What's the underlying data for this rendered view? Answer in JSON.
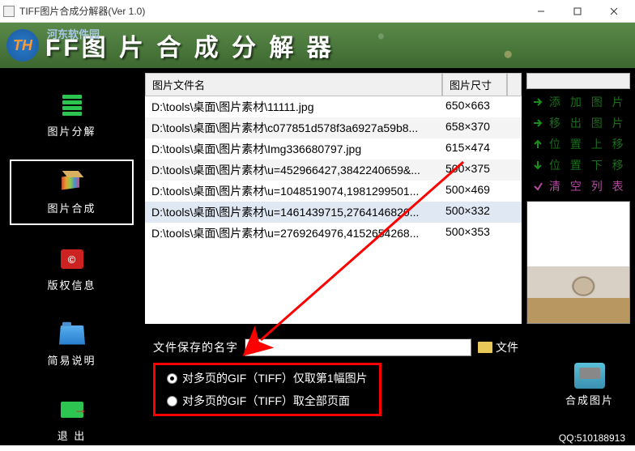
{
  "window": {
    "title": "TIFF图片合成分解器(Ver 1.0)"
  },
  "banner": {
    "logo_text": "TH",
    "sub": "河东软件园",
    "title": "FF图 片 合 成 分 解 器"
  },
  "sidebar": {
    "items": [
      {
        "label": "图片分解"
      },
      {
        "label": "图片合成"
      },
      {
        "label": "版权信息"
      },
      {
        "label": "简易说明"
      },
      {
        "label": "退 出"
      }
    ]
  },
  "table": {
    "col_name": "图片文件名",
    "col_size": "图片尺寸",
    "rows": [
      {
        "name": "D:\\tools\\桌面\\图片素材\\11111.jpg",
        "size": "650×663"
      },
      {
        "name": "D:\\tools\\桌面\\图片素材\\c077851d578f3a6927a59b8...",
        "size": "658×370"
      },
      {
        "name": "D:\\tools\\桌面\\图片素材\\Img336680797.jpg",
        "size": "615×474"
      },
      {
        "name": "D:\\tools\\桌面\\图片素材\\u=452966427,3842240659&...",
        "size": "500×375"
      },
      {
        "name": "D:\\tools\\桌面\\图片素材\\u=1048519074,1981299501...",
        "size": "500×469"
      },
      {
        "name": "D:\\tools\\桌面\\图片素材\\u=1461439715,2764146820...",
        "size": "500×332"
      },
      {
        "name": "D:\\tools\\桌面\\图片素材\\u=2769264976,4152654268...",
        "size": "500×353"
      }
    ]
  },
  "actions": {
    "add": "添 加 图 片",
    "remove": "移 出 图 片",
    "up": "位 置 上 移",
    "down": "位 置 下 移",
    "clear": "清 空 列 表"
  },
  "save": {
    "label": "文件保存的名字",
    "value": "",
    "file_btn": "文件"
  },
  "radio": {
    "opt1": "对多页的GIF（TIFF）仅取第1幅图片",
    "opt2": "对多页的GIF（TIFF）取全部页面"
  },
  "compose_btn": "合成图片",
  "qq": "QQ:510188913",
  "copyright_glyph": "©"
}
